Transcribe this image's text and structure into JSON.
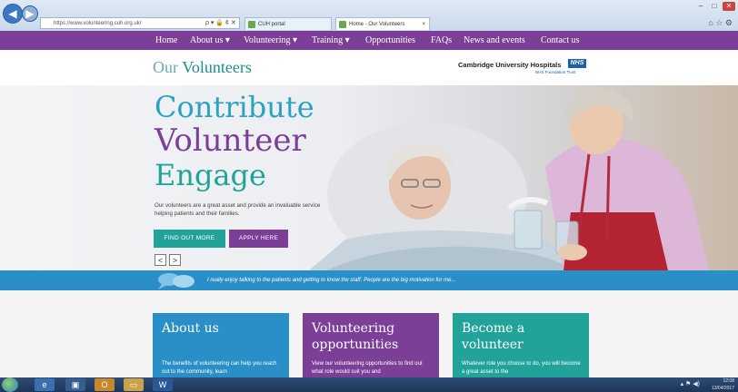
{
  "browser": {
    "url": "https://www.volunteering.cuh.org.uk/",
    "address_controls": "ρ ▾ 🔒 ¢ ✕",
    "tabs": [
      {
        "label": "CUH portal"
      },
      {
        "label": "Home - Our Volunteers"
      }
    ],
    "tab_close": "×"
  },
  "nav": {
    "items": [
      {
        "label": "Home"
      },
      {
        "label": "About us ▾"
      },
      {
        "label": "Volunteering ▾"
      },
      {
        "label": "Training ▾"
      },
      {
        "label": "Opportunities"
      },
      {
        "label": "FAQs"
      },
      {
        "label": "News and events"
      },
      {
        "label": "Contact us"
      }
    ]
  },
  "header": {
    "brand_prefix": "Our",
    "brand_main": "Volunteers",
    "org_name": "Cambridge University Hospitals",
    "nhs_logo": "NHS",
    "trust_line": "NHS Foundation Trust"
  },
  "hero": {
    "headlines": [
      "Contribute",
      "Volunteer",
      "Engage"
    ],
    "body": "Our volunteers are a great asset and provide an invaluable service helping patients and their families.",
    "find_out_more": "FIND OUT MORE",
    "apply_here": "APPLY HERE",
    "prev": "<",
    "next": ">"
  },
  "quote": {
    "text": "I really enjoy talking to the patients and getting to know the staff. People are the big motivation for me..."
  },
  "cards": [
    {
      "title": "About us",
      "body": "The benefits of volunteering can help you reach out to the community, learn"
    },
    {
      "title": "Volunteering opportunities",
      "body": "View our volunteering opportunities to find out what role would suit you and"
    },
    {
      "title": "Become a volunteer",
      "body": "Whatever role you choose to do, you will become a great asset to the"
    }
  ],
  "taskbar": {
    "time": "12:08",
    "date": "13/04/2017"
  },
  "colors": {
    "purple": "#7b3f98",
    "teal": "#22a39a",
    "blue": "#2a8fc6"
  }
}
